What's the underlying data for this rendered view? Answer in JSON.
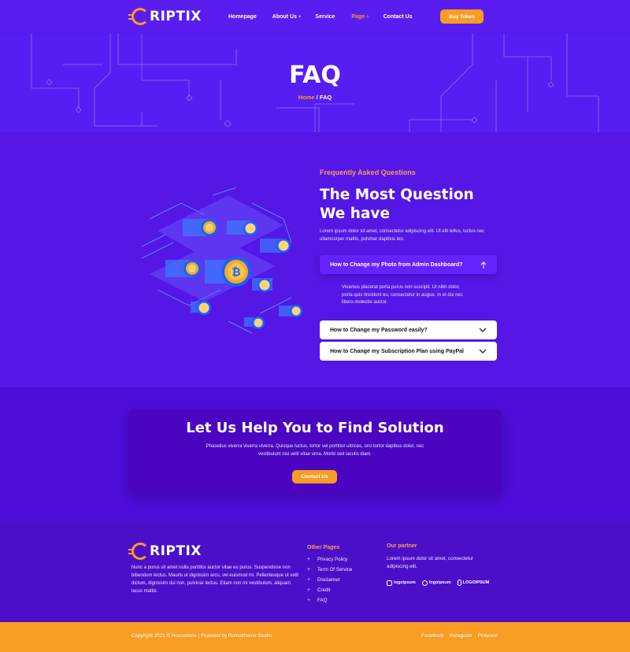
{
  "brand": {
    "name": "RIPTIX",
    "accent": "#f99c24",
    "primary": "#5417e6"
  },
  "nav": {
    "items": [
      {
        "label": "Homepage",
        "caret": ""
      },
      {
        "label": "About Us",
        "caret": "+"
      },
      {
        "label": "Service",
        "caret": ""
      },
      {
        "label": "Page",
        "caret": "+"
      },
      {
        "label": "Contact Us",
        "caret": ""
      }
    ],
    "cta": "Buy Token"
  },
  "hero": {
    "title": "FAQ",
    "crumb_home": "Home",
    "crumb_sep": " / ",
    "crumb_current": "FAQ"
  },
  "faq": {
    "eyebrow": "Frequently Asked Questions",
    "title_line1": "The Most Question",
    "title_line2": "We have",
    "intro": "Lorem ipsum dolor sit amet, consectetur adipiscing elit. Ut elit tellus, luctus nec ullamcorper mattis, pulvinar dapibus leo.",
    "items": [
      {
        "question": "How to Change my Photo from Admin Dashboard?",
        "answer": "Vivamus placerat porta purus non suscipit. Ut nibh dolor, porta quis tincidunt eu, consectetur in augue. In et dui nec libero molestie auctor.",
        "open": true
      },
      {
        "question": "How to Change my Password easily?",
        "open": false
      },
      {
        "question": "How to Change my Subscription Plan using PayPal",
        "open": false
      }
    ]
  },
  "help": {
    "title": "Let Us Help You to Find Solution",
    "text": "Phasellus viverra viverra viverra. Quisque luctus, tortor vel porttitor ultrices, orci tortor dapibus dolor, nec vestibulum nisi velit vitae urna. Morbi sed iaculis diam.",
    "button": "Contact Us"
  },
  "footer": {
    "description": "Nunc a purus sit amet nulla porttitor auctor vitae eu purus. Suspendisse non bibendum lectus. Mauris ut dignissim arcu, vel euismod mi. Pellentesque ut velit dictum, dignissim dui non, pulvinar lectus. Etiam non mi vestibulum, aliquam lacus mattis.",
    "pages_title": "Other Pages",
    "pages": [
      "Privacy Policy",
      "Term Of Service",
      "Disclaimer",
      "Credit",
      "FAQ"
    ],
    "partner_title": "Our partner",
    "partner_text": "Lorem ipsum dolor sit amet, consectetur adipiscing elit.",
    "partner_logos": [
      "logoipsum",
      "logoipsum",
      "LOGOIPSUM"
    ],
    "copyright": "Copyright 2021 © Housedeco | Powered by Romeltheme Studio",
    "social": [
      "Facebook",
      "Instagram",
      "Pinterest"
    ]
  }
}
